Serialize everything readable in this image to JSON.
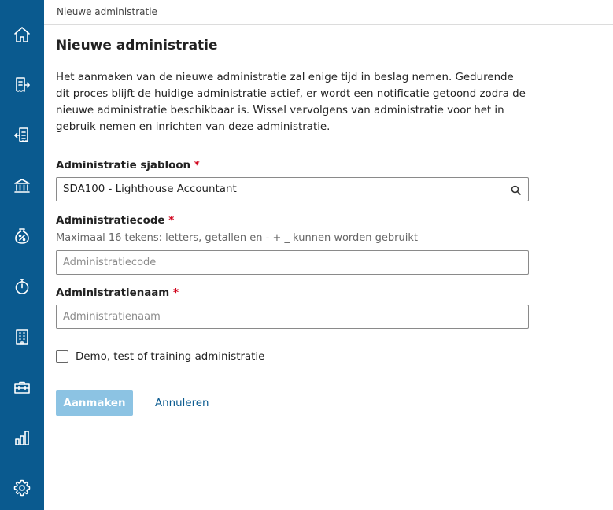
{
  "breadcrumb": "Nieuwe administratie",
  "page_title": "Nieuwe administratie",
  "intro_text": "Het aanmaken van de nieuwe administratie zal enige tijd in beslag nemen. Gedurende dit proces blijft de huidige administratie actief, er wordt een notificatie getoond zodra de nieuwe administratie beschikbaar is. Wissel vervolgens van administratie voor het in gebruik nemen en inrichten van deze administratie.",
  "sidebar": {
    "background": "#0a5a8f",
    "items": [
      {
        "icon": "home-icon"
      },
      {
        "icon": "sales-invoice-icon"
      },
      {
        "icon": "purchase-invoice-icon"
      },
      {
        "icon": "bank-icon"
      },
      {
        "icon": "vat-percentage-icon"
      },
      {
        "icon": "stopwatch-icon"
      },
      {
        "icon": "building-icon"
      },
      {
        "icon": "toolbox-icon"
      },
      {
        "icon": "bar-chart-icon"
      },
      {
        "icon": "gear-icon"
      }
    ]
  },
  "form": {
    "template": {
      "label": "Administratie sjabloon",
      "required_mark": "*",
      "value": "SDA100 - Lighthouse Accountant"
    },
    "code": {
      "label": "Administratiecode",
      "required_mark": "*",
      "hint": "Maximaal 16 tekens: letters, getallen en - + _ kunnen worden gebruikt",
      "placeholder": "Administratiecode",
      "value": ""
    },
    "name": {
      "label": "Administratienaam",
      "required_mark": "*",
      "placeholder": "Administratienaam",
      "value": ""
    },
    "demo_checkbox": {
      "label": "Demo, test of training administratie",
      "checked": false
    }
  },
  "actions": {
    "create_label": "Aanmaken",
    "create_enabled": false,
    "cancel_label": "Annuleren"
  },
  "colors": {
    "accent": "#0a5a8f",
    "required": "#d0021b",
    "disabled_button": "#8cc3e3"
  }
}
